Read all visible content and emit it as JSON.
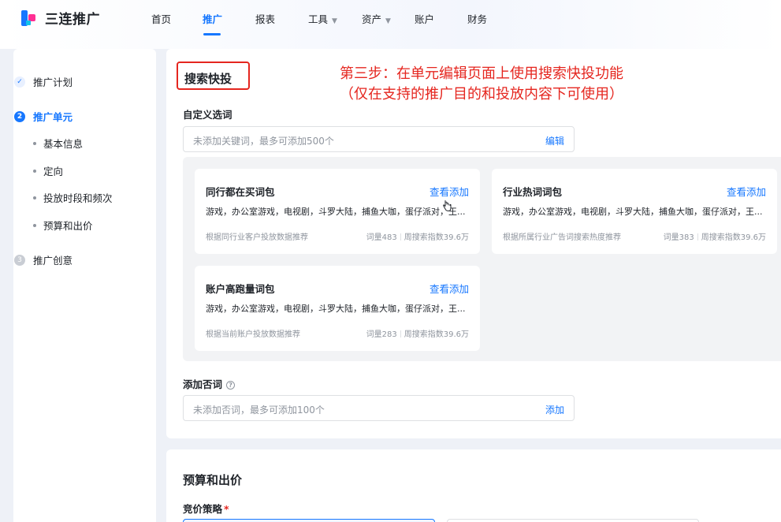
{
  "app": {
    "logo_text": "三连推广"
  },
  "nav": {
    "items": [
      {
        "label": "首页"
      },
      {
        "label": "推广"
      },
      {
        "label": "报表"
      },
      {
        "label": "工具"
      },
      {
        "label": "资产"
      },
      {
        "label": "账户"
      },
      {
        "label": "财务"
      }
    ],
    "active": "推广"
  },
  "sidebar": {
    "steps": [
      {
        "label": "推广计划",
        "state": "done",
        "marker": "✓"
      },
      {
        "label": "推广单元",
        "state": "current",
        "marker": "2"
      },
      {
        "label": "推广创意",
        "state": "todo",
        "marker": "3"
      }
    ],
    "sub_items": [
      "基本信息",
      "定向",
      "投放时段和频次",
      "预算和出价"
    ]
  },
  "section": {
    "title": "搜索快投",
    "annotation_line1": "第三步：在单元编辑页面上使用搜索快投功能",
    "annotation_line2": "（仅在支持的推广目的和投放内容下可使用）"
  },
  "keywords": {
    "label": "自定义选词",
    "placeholder": "未添加关键词，最多可添加500个",
    "action": "编辑"
  },
  "packs": [
    {
      "name": "同行都在买词包",
      "link": "查看添加",
      "words": "游戏，办公室游戏，电视剧，斗罗大陆，捕鱼大咖，蛋仔派对，王...",
      "source": "根据同行业客户投放数据推荐",
      "count": "词量483",
      "index": "周搜索指数39.6万"
    },
    {
      "name": "行业热词词包",
      "link": "查看添加",
      "words": "游戏，办公室游戏，电视剧，斗罗大陆，捕鱼大咖，蛋仔派对，王...",
      "source": "根据所属行业广告词搜索热度推荐",
      "count": "词量383",
      "index": "周搜索指数39.6万"
    },
    {
      "name": "账户高跑量词包",
      "link": "查看添加",
      "words": "游戏，办公室游戏，电视剧，斗罗大陆，捕鱼大咖，蛋仔派对，王...",
      "source": "根据当前账户投放数据推荐",
      "count": "词量283",
      "index": "周搜索指数39.6万"
    }
  ],
  "negative": {
    "label": "添加否词",
    "placeholder": "未添加否词，最多可添加100个",
    "action": "添加"
  },
  "budget": {
    "title": "预算和出价",
    "bid_label": "竞价策略",
    "required_mark": "*"
  },
  "colors": {
    "accent": "#1677ff",
    "annotation": "#e5261f"
  }
}
